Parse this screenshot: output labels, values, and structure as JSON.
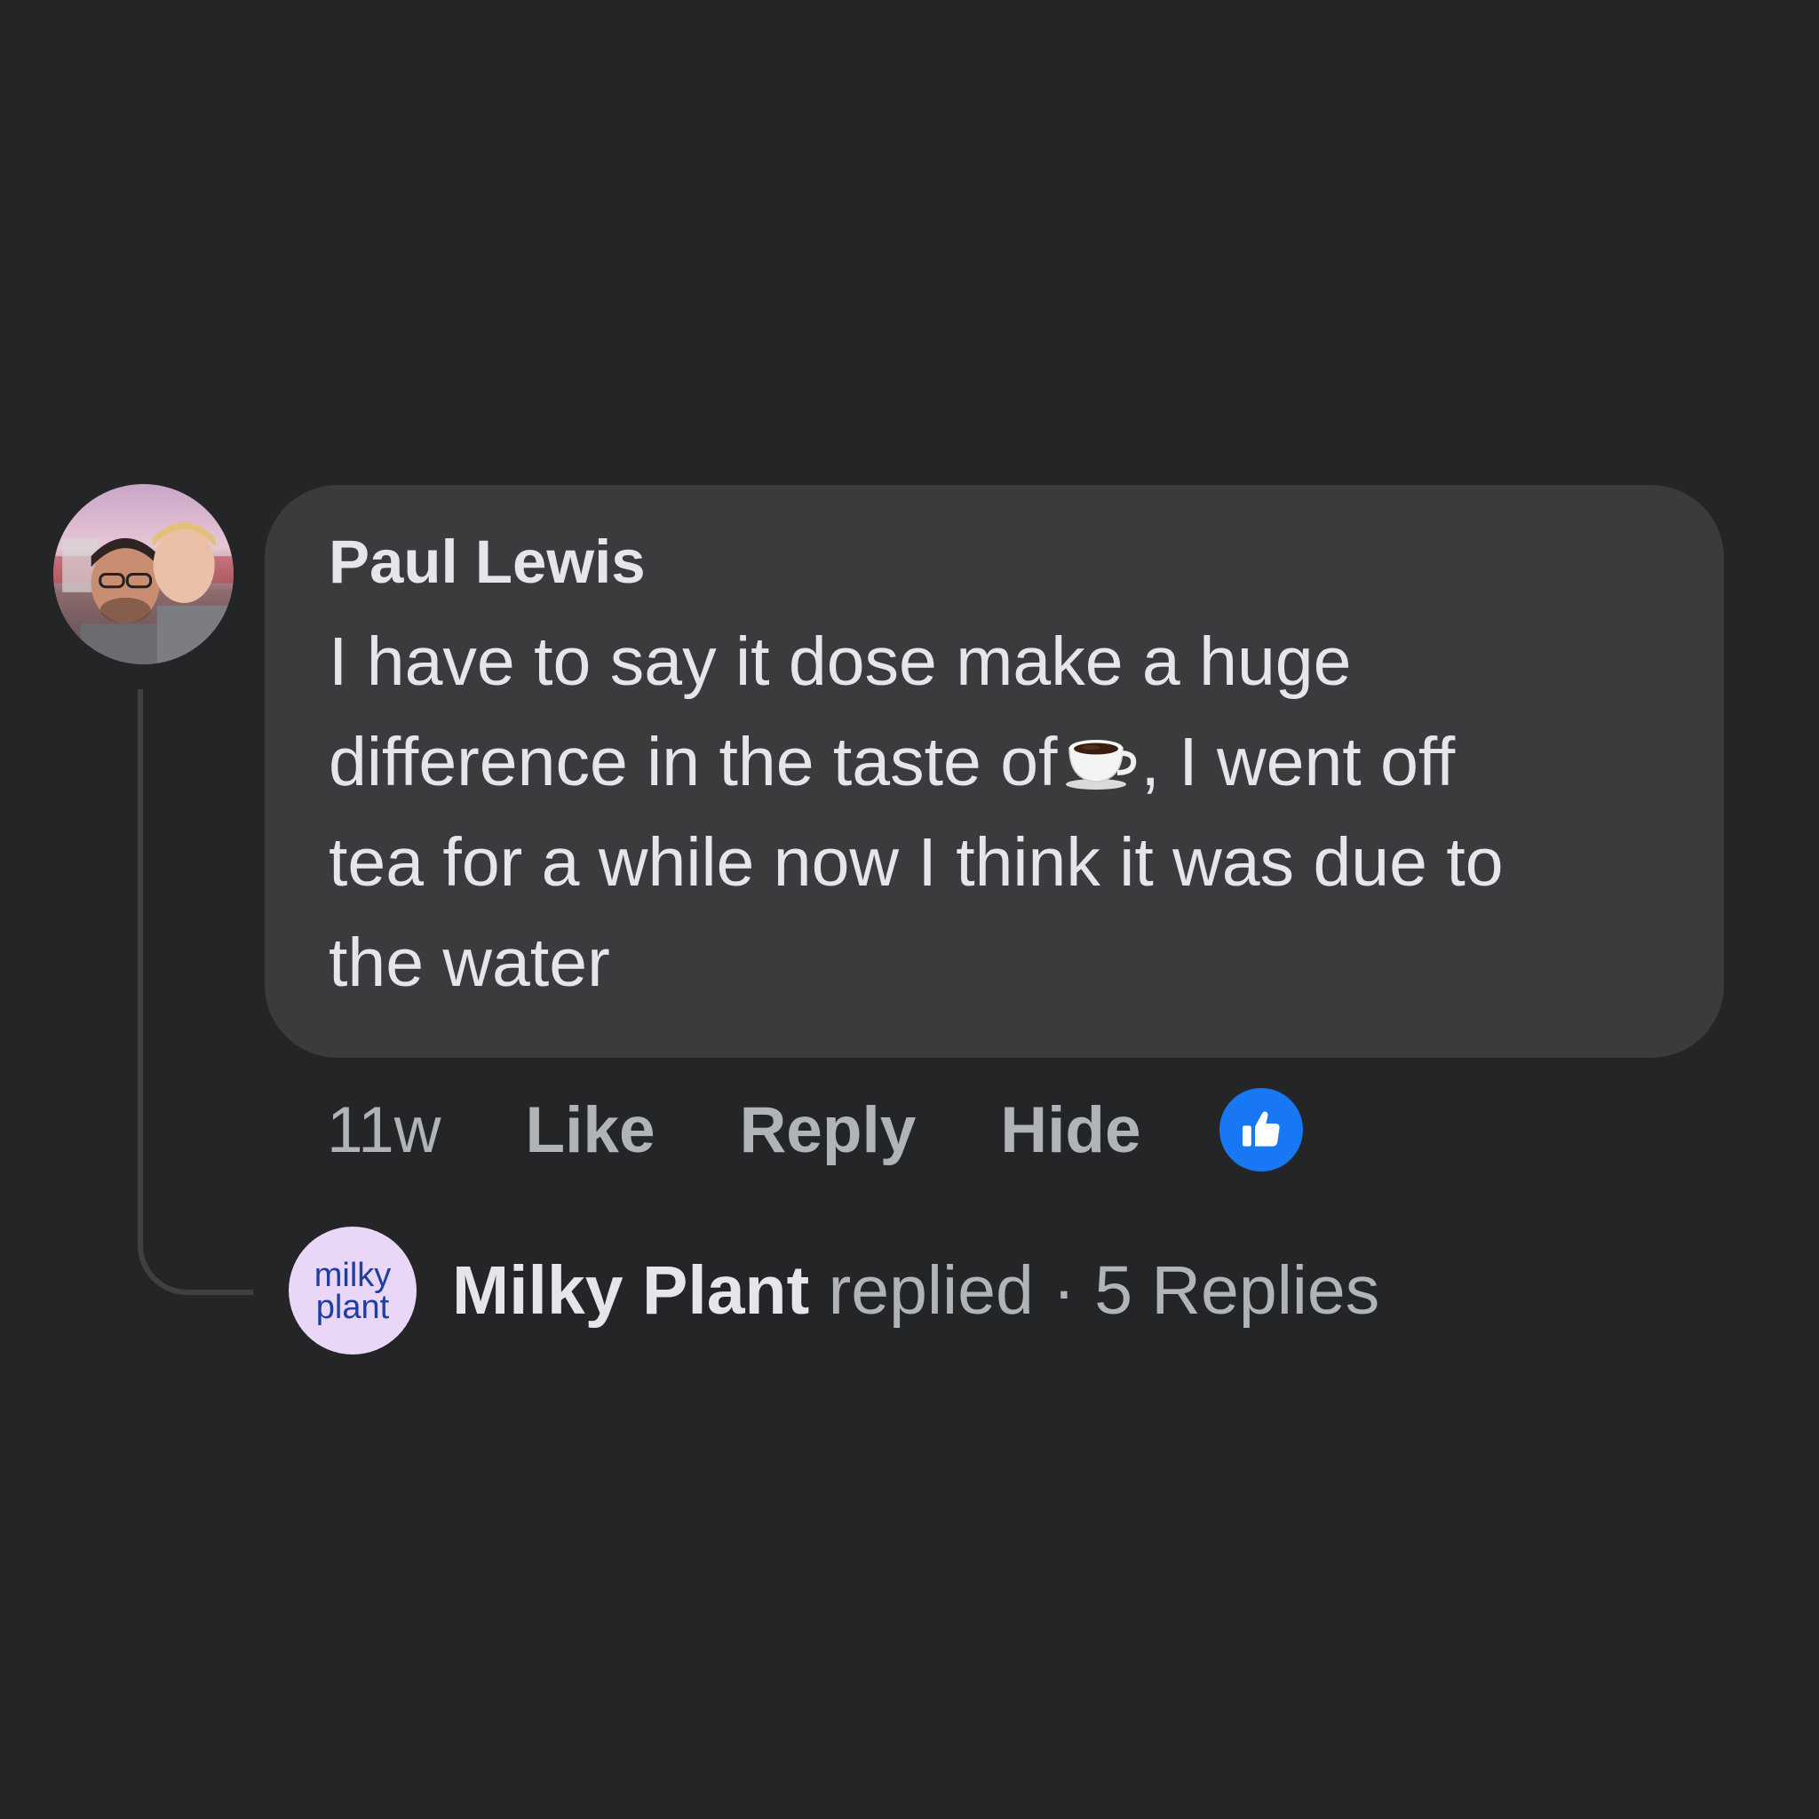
{
  "comment": {
    "author": "Paul Lewis",
    "text_part1": "I have to say it dose make a huge\ndifference in the taste of",
    "emoji": "coffee-cup",
    "text_part2": ", I went off\ntea for a while now I think it was due to\nthe water",
    "avatar_icon": "profile-photo"
  },
  "meta": {
    "time": "11w",
    "like_label": "Like",
    "reply_label": "Reply",
    "hide_label": "Hide",
    "reaction_icon": "thumbs-up-icon"
  },
  "reply_summary": {
    "avatar_line1": "milky",
    "avatar_line2": "plant",
    "name": "Milky Plant",
    "verb": " replied",
    "separator": " · ",
    "count_label": "5 Replies"
  },
  "colors": {
    "background": "#242527",
    "bubble": "#3a3b3c",
    "primary_text": "#e4e6eb",
    "secondary_text": "#b0b3b8",
    "like_blue": "#1877f2",
    "brand_avatar_bg": "#ead6f7",
    "brand_avatar_text": "#1c3fa0"
  }
}
